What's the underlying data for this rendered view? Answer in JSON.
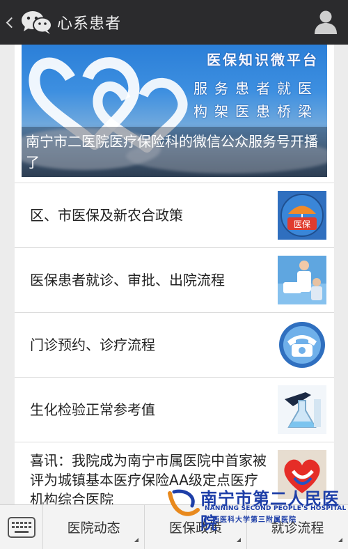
{
  "topbar": {
    "title": "心系患者"
  },
  "banner": {
    "right_line1": "医保知识微平台",
    "right_line2": "服务患者就医",
    "right_line3": "构架医患桥梁",
    "caption": "南宁市二医院医疗保险科的微信公众服务号开播了"
  },
  "list": [
    {
      "label": "区、市医保及新农合政策",
      "thumb": "医保 umbrella logo"
    },
    {
      "label": "医保患者就诊、审批、出院流程",
      "thumb": "doctor and patient photo"
    },
    {
      "label": "门诊预约、诊疗流程",
      "thumb": "telephone icon"
    },
    {
      "label": "生化检验正常参考值",
      "thumb": "lab flask photo"
    },
    {
      "label": "喜讯：我院成为南宁市属医院中首家被评为城镇基本医疗保险AA级定点医疗机构综合医院",
      "thumb": "hospital heart logo"
    }
  ],
  "bottom_menu": {
    "items": [
      "医院动态",
      "医保政策",
      "就诊流程"
    ]
  },
  "watermark": {
    "main": "南宁市第二人民医院",
    "english": "NANNING SECOND PEOPLE'S HOSPITAL",
    "sub": "广西医科大学第三附属医院"
  },
  "colors": {
    "topbar_bg": "#2b2b2d",
    "watermark": "#1e3fa8",
    "bottom_bg": "#f3f3f3"
  }
}
